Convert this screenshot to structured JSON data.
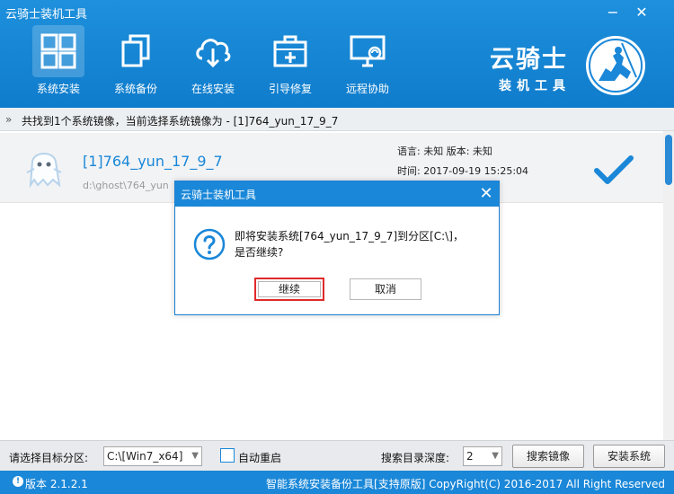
{
  "window": {
    "title": "云骑士装机工具",
    "minimize": "−",
    "close": "✕"
  },
  "nav": [
    {
      "label": "系统安装",
      "icon": "windows-icon",
      "active": true
    },
    {
      "label": "系统备份",
      "icon": "copy-icon"
    },
    {
      "label": "在线安装",
      "icon": "cloud-download-icon"
    },
    {
      "label": "引导修复",
      "icon": "medkit-icon"
    },
    {
      "label": "远程协助",
      "icon": "remote-monitor-icon"
    }
  ],
  "brand": {
    "main": "云骑士",
    "sub": "装机工具"
  },
  "infobar": {
    "text": "共找到1个系统镜像，当前选择系统镜像为 - [1]764_yun_17_9_7"
  },
  "images": [
    {
      "name": "[1]764_yun_17_9_7",
      "path": "d:\\ghost\\764_yun",
      "lang": "语言: 未知   版本: 未知",
      "time": "时间: 2017-09-19 15:25:04"
    }
  ],
  "dialog": {
    "title": "云骑士装机工具",
    "message_line1": "即将安装系统[764_yun_17_9_7]到分区[C:\\]，",
    "message_line2": "是否继续?",
    "continue_label": "继续",
    "cancel_label": "取消"
  },
  "toolbar": {
    "target_label": "请选择目标分区:",
    "target_value": "C:\\[Win7_x64]",
    "auto_restart_label": "自动重启",
    "depth_label": "搜索目录深度:",
    "depth_value": "2",
    "search_button": "搜索镜像",
    "install_button": "安装系统"
  },
  "status": {
    "version": "版本 2.1.2.1",
    "right_text": "智能系统安装备份工具[支持原版]  CopyRight(C) 2016-2017 All Right Reserved"
  }
}
